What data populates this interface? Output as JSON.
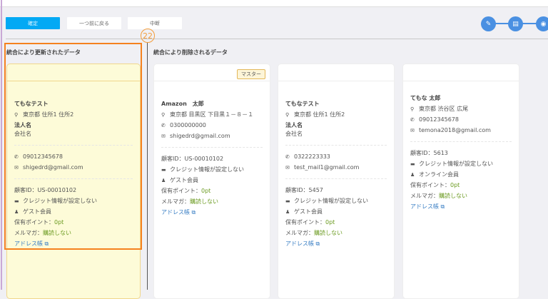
{
  "toolbar": {
    "confirm": "確定",
    "back": "一つ前に戻る",
    "abort": "中断"
  },
  "marker": "22",
  "columns": {
    "updated": "統合により更新されたデータ",
    "deleted": "統合により削除されるデータ"
  },
  "master_badge": "マスター",
  "labels": {
    "corp_label": "法人名",
    "points": "保有ポイント：",
    "mailmag": "メルマガ：",
    "address_book": "アドレス帳"
  },
  "cards": [
    {
      "name": "てもなテスト",
      "address": "東京都 住所1 住所2",
      "corp": "会社名",
      "phone": "09012345678",
      "email": "shigedrd@gmail.com",
      "id": "顧客ID：US-00010102",
      "credit": "クレジット情報が設定しない",
      "member": "ゲスト会員",
      "points": "0pt",
      "mailmag": "購読しない"
    },
    {
      "name": "Amazon　太郎",
      "address": "東京都 目黒区 下目黒１－８－１",
      "phone": "0300000000",
      "email": "shigedrd@gmail.com",
      "id": "顧客ID：US-00010102",
      "credit": "クレジット情報が設定しない",
      "member": "ゲスト会員",
      "points": "0pt",
      "mailmag": "購読しない"
    },
    {
      "name": "てもなテスト",
      "address": "東京都 住所1 住所2",
      "corp": "会社名",
      "phone": "0322223333",
      "email": "test_mail1@gmail.com",
      "id": "顧客ID：5457",
      "credit": "クレジット情報が設定しない",
      "member": "ゲスト会員",
      "points": "0pt",
      "mailmag": "購読しない"
    },
    {
      "name": "てもな 太郎",
      "address": "東京都 渋谷区 広尾",
      "phone": "09012345678",
      "email": "temona2018@gmail.com",
      "id": "顧客ID：5613",
      "credit": "クレジット情報が設定しない",
      "member": "オンライン会員",
      "points": "0pt",
      "mailmag": "購読しない"
    }
  ]
}
